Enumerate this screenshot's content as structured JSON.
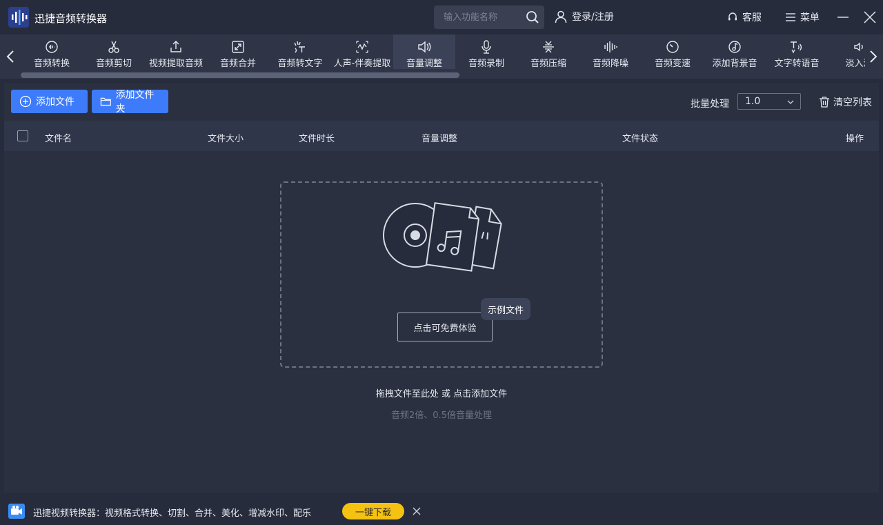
{
  "app": {
    "title": "迅捷音频转换器"
  },
  "search": {
    "placeholder": "输入功能名称"
  },
  "header": {
    "login": "登录/注册",
    "service": "客服",
    "menu": "菜单"
  },
  "tools": [
    {
      "label": "音频转换",
      "icon": "audio-convert-icon"
    },
    {
      "label": "音频剪切",
      "icon": "scissors-icon"
    },
    {
      "label": "视频提取音频",
      "icon": "upload-icon"
    },
    {
      "label": "音频合并",
      "icon": "merge-icon"
    },
    {
      "label": "音频转文字",
      "icon": "speech-to-text-icon"
    },
    {
      "label": "人声-伴奏提取",
      "icon": "vocal-extract-icon"
    },
    {
      "label": "音量调整",
      "icon": "volume-icon",
      "active": true
    },
    {
      "label": "音频录制",
      "icon": "microphone-icon"
    },
    {
      "label": "音频压缩",
      "icon": "compress-icon"
    },
    {
      "label": "音频降噪",
      "icon": "denoise-icon"
    },
    {
      "label": "音频变速",
      "icon": "speed-icon"
    },
    {
      "label": "添加背景音",
      "icon": "music-note-icon"
    },
    {
      "label": "文字转语音",
      "icon": "text-to-speech-icon"
    },
    {
      "label": "淡入淡",
      "icon": "fade-icon"
    }
  ],
  "actions": {
    "add_file": "添加文件",
    "add_folder": "添加文件夹",
    "batch_label": "批量处理",
    "batch_value": "1.0",
    "clear_list": "清空列表"
  },
  "table": {
    "columns": [
      "文件名",
      "文件大小",
      "文件时长",
      "音量调整",
      "文件状态",
      "操作"
    ]
  },
  "dropzone": {
    "try_button": "点击可免费体验",
    "sample_tag": "示例文件",
    "hint": "拖拽文件至此处 或 点击添加文件",
    "sub_hint": "音频2倍、0.5倍音量处理"
  },
  "footer": {
    "promo": "迅捷视频转换器：视频格式转换、切割、合并、美化、增减水印、配乐",
    "download": "一键下载"
  },
  "colors": {
    "background": "#272c3d",
    "toolbar": "#2f3547",
    "accent": "#3e7bfa",
    "download": "#f5c211"
  }
}
